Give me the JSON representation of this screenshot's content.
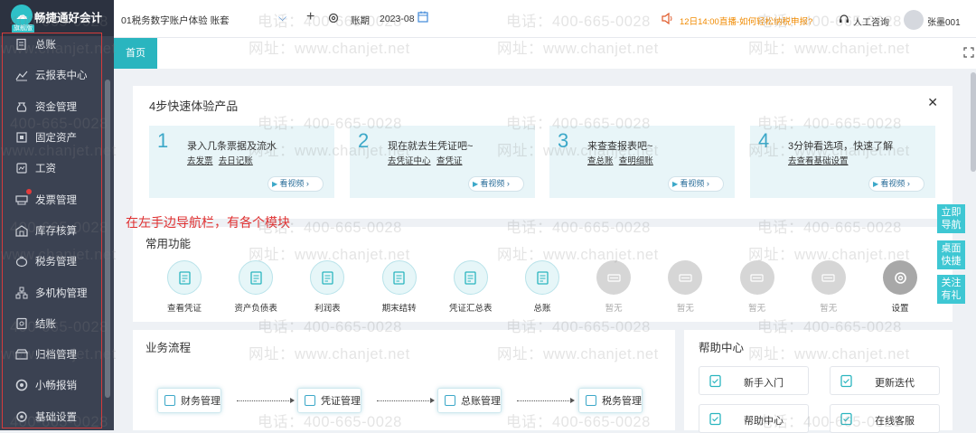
{
  "brand": {
    "name": "畅捷通好会计",
    "edition": "旗舰版"
  },
  "sidebar": {
    "items": [
      {
        "label": "总账",
        "icon": "ledger-icon"
      },
      {
        "label": "云报表中心",
        "icon": "chart-icon"
      },
      {
        "label": "资金管理",
        "icon": "money-bag-icon"
      },
      {
        "label": "固定资产",
        "icon": "asset-icon"
      },
      {
        "label": "工资",
        "icon": "salary-icon"
      },
      {
        "label": "发票管理",
        "icon": "invoice-icon"
      },
      {
        "label": "库存核算",
        "icon": "warehouse-icon"
      },
      {
        "label": "税务管理",
        "icon": "tax-icon"
      },
      {
        "label": "多机构管理",
        "icon": "org-icon"
      },
      {
        "label": "结账",
        "icon": "closing-icon"
      },
      {
        "label": "归档管理",
        "icon": "archive-icon"
      },
      {
        "label": "小畅报销",
        "icon": "reimburse-icon"
      },
      {
        "label": "基础设置",
        "icon": "settings-icon"
      }
    ]
  },
  "topbar": {
    "account": "01税务数字账户体验 账套",
    "period_label": "账期",
    "period_value": "2023-08",
    "notice": "12日14:00直播-如何轻松纳税申报?",
    "support": "人工咨询",
    "user": "张墨001"
  },
  "tabs": [
    {
      "label": "首页"
    }
  ],
  "quickstart": {
    "title": "4步快速体验产品",
    "steps": [
      {
        "num": "1",
        "title": "录入几条票据及流水",
        "links": [
          "去发票",
          "去日记账"
        ],
        "video": "看视频"
      },
      {
        "num": "2",
        "title": "现在就去生凭证吧~",
        "links": [
          "去凭证中心",
          "查凭证"
        ],
        "video": "看视频"
      },
      {
        "num": "3",
        "title": "来查查报表吧~",
        "links": [
          "查总账",
          "查明细账"
        ],
        "video": "看视频"
      },
      {
        "num": "4",
        "title": "3分钟看选项，快速了解",
        "links": [
          "去查看基础设置"
        ],
        "video": "看视频"
      }
    ]
  },
  "annotation": "在左手边导航栏，有各个模块",
  "common_functions": {
    "title": "常用功能",
    "items": [
      {
        "label": "查看凭证",
        "state": "active",
        "icon": "voucher-search-icon"
      },
      {
        "label": "资产负债表",
        "state": "active",
        "icon": "balance-sheet-icon"
      },
      {
        "label": "利润表",
        "state": "active",
        "icon": "profit-icon"
      },
      {
        "label": "期末结转",
        "state": "active",
        "icon": "transfer-icon"
      },
      {
        "label": "凭证汇总表",
        "state": "active",
        "icon": "summary-icon"
      },
      {
        "label": "总账",
        "state": "active",
        "icon": "ledger-book-icon"
      },
      {
        "label": "暂无",
        "state": "empty",
        "icon": "empty-icon"
      },
      {
        "label": "暂无",
        "state": "empty",
        "icon": "empty-icon"
      },
      {
        "label": "暂无",
        "state": "empty",
        "icon": "empty-icon"
      },
      {
        "label": "暂无",
        "state": "empty",
        "icon": "empty-icon"
      },
      {
        "label": "设置",
        "state": "settings",
        "icon": "gear-icon"
      }
    ]
  },
  "business_flow": {
    "title": "业务流程",
    "steps": [
      "财务管理",
      "凭证管理",
      "总账管理",
      "税务管理"
    ]
  },
  "help_center": {
    "title": "帮助中心",
    "items": [
      "新手入门",
      "更新迭代",
      "帮助中心",
      "在线客服"
    ]
  },
  "float_buttons": [
    "立即导航",
    "桌面快捷",
    "关注有礼"
  ],
  "watermark": {
    "phone": "电话：400-665-0028",
    "site": "网址：www.chanjet.net"
  },
  "colors": {
    "accent": "#2ab5bf",
    "sidebar": "#3b4252",
    "notice": "#f08a00",
    "annotation": "#e03030"
  }
}
